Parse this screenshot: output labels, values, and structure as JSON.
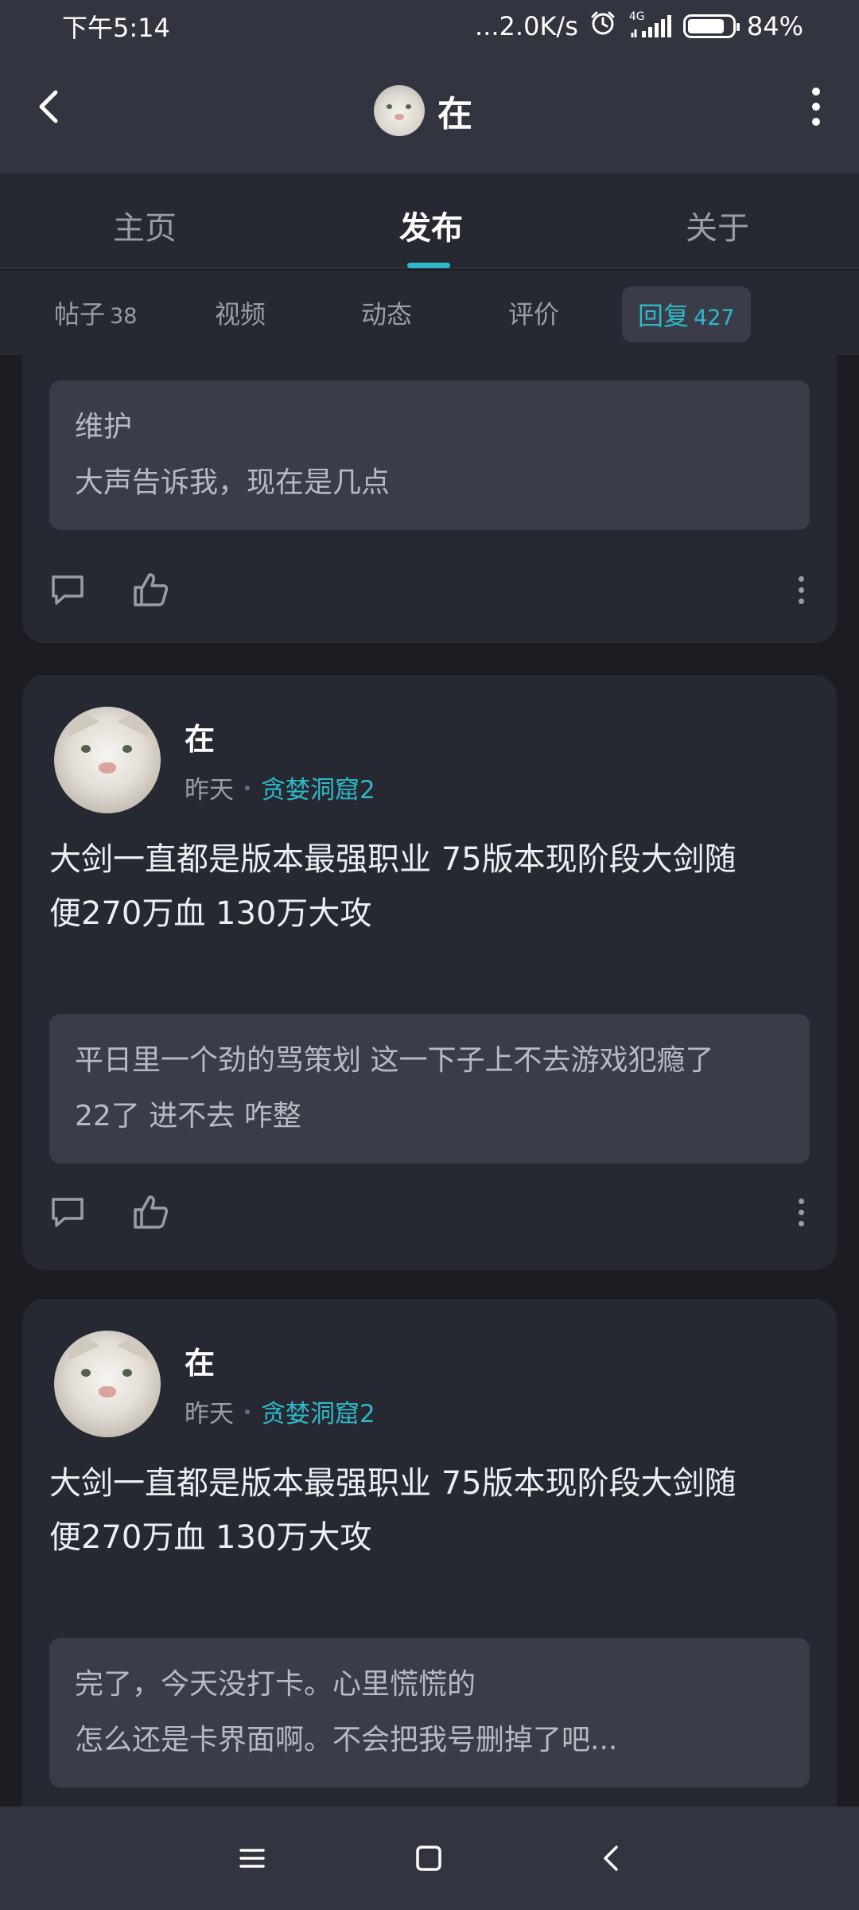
{
  "status_bar": {
    "time": "下午5:14",
    "network_speed": "...2.0K/s",
    "network_type": "4G",
    "battery_level": 84,
    "battery_text": "84%"
  },
  "header": {
    "title": "在",
    "back_icon": "chevron-left-icon",
    "more_icon": "more-vertical-icon"
  },
  "main_tabs": [
    {
      "label": "主页",
      "active": false
    },
    {
      "label": "发布",
      "active": true
    },
    {
      "label": "关于",
      "active": false
    }
  ],
  "sub_tabs": [
    {
      "label": "帖子",
      "count": "38",
      "active": false
    },
    {
      "label": "视频",
      "count": "",
      "active": false
    },
    {
      "label": "动态",
      "count": "",
      "active": false
    },
    {
      "label": "评价",
      "count": "",
      "active": false
    },
    {
      "label": "回复",
      "count": "427",
      "active": true
    }
  ],
  "posts": [
    {
      "partial": true,
      "quote_lines": [
        "维护",
        "大声告诉我，现在是几点"
      ]
    },
    {
      "user_name": "在",
      "time": "昨天",
      "game": "贪婪洞窟2",
      "text_lines": [
        "大剑一直都是版本最强职业 75版本现阶段大剑随",
        "便270万血 130万大攻"
      ],
      "quote_lines": [
        "平日里一个劲的骂策划 这一下子上不去游戏犯瘾了",
        "22了 进不去 咋整"
      ]
    },
    {
      "user_name": "在",
      "time": "昨天",
      "game": "贪婪洞窟2",
      "text_lines": [
        "大剑一直都是版本最强职业 75版本现阶段大剑随",
        "便270万血 130万大攻"
      ],
      "quote_lines": [
        "完了，今天没打卡。心里慌慌的",
        "怎么还是卡界面啊。不会把我号删掉了吧..."
      ]
    }
  ],
  "colors": {
    "accent": "#2fb8c7",
    "background": "#1c1d23",
    "card": "#262832",
    "quote": "#3a3d49",
    "chrome": "#32343f"
  },
  "nav_bar": {
    "menu_icon": "menu-icon",
    "home_icon": "home-square-icon",
    "back_icon": "back-triangle-icon"
  }
}
